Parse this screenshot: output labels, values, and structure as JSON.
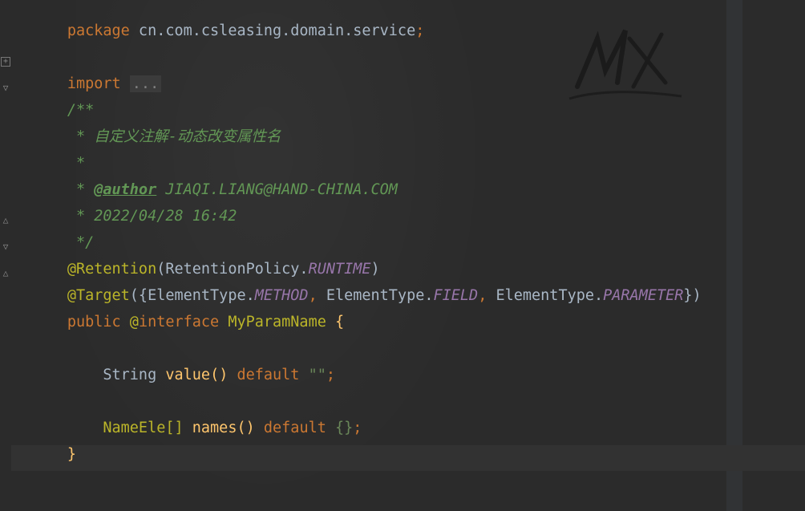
{
  "editor": {
    "lines": {
      "package_kw": "package",
      "package_name": " cn.com.csleasing.domain.service",
      "package_semi": ";",
      "import_kw": "import",
      "import_ellipsis": "...",
      "doc_open": "/**",
      "doc_desc": " * 自定义注解-动态改变属性名",
      "doc_star": " *",
      "doc_author_prefix": " * ",
      "doc_author_tag": "@author",
      "doc_author_value": " JIAQI.LIANG@HAND-CHINA.COM",
      "doc_date": " * 2022/04/28 16:42",
      "doc_close": " */",
      "retention_ann": "@Retention",
      "retention_open": "(",
      "retention_cls": "RetentionPolicy.",
      "retention_field": "RUNTIME",
      "retention_close": ")",
      "target_ann": "@Target",
      "target_open": "({",
      "target_cls1": "ElementType.",
      "target_field1": "METHOD",
      "target_sep1": ", ",
      "target_cls2": "ElementType.",
      "target_field2": "FIELD",
      "target_sep2": ", ",
      "target_cls3": "ElementType.",
      "target_field3": "PARAMETER",
      "target_close": "})",
      "decl_public": "public ",
      "decl_at": "@",
      "decl_interface": "interface",
      "decl_name": " MyParamName ",
      "decl_brace": "{",
      "m1_type": "    String ",
      "m1_name": "value",
      "m1_parens": "() ",
      "m1_default": "default",
      "m1_value": " \"\"",
      "m1_semi": ";",
      "m2_type": "    NameEle[] ",
      "m2_name": "names",
      "m2_parens": "() ",
      "m2_default": "default",
      "m2_value": " {}",
      "m2_semi": ";",
      "close_brace": "}"
    }
  },
  "colors": {
    "background": "#2b2b2b",
    "keyword": "#cc7832",
    "annotation": "#bbb529",
    "doc_comment": "#629755",
    "static_field": "#9876aa",
    "method": "#ffc66d",
    "string": "#6a8759",
    "text": "#a9b7c6"
  },
  "icons": {
    "fold_expand": "fold-expand-icon",
    "fold_collapse": "fold-collapse-icon"
  }
}
